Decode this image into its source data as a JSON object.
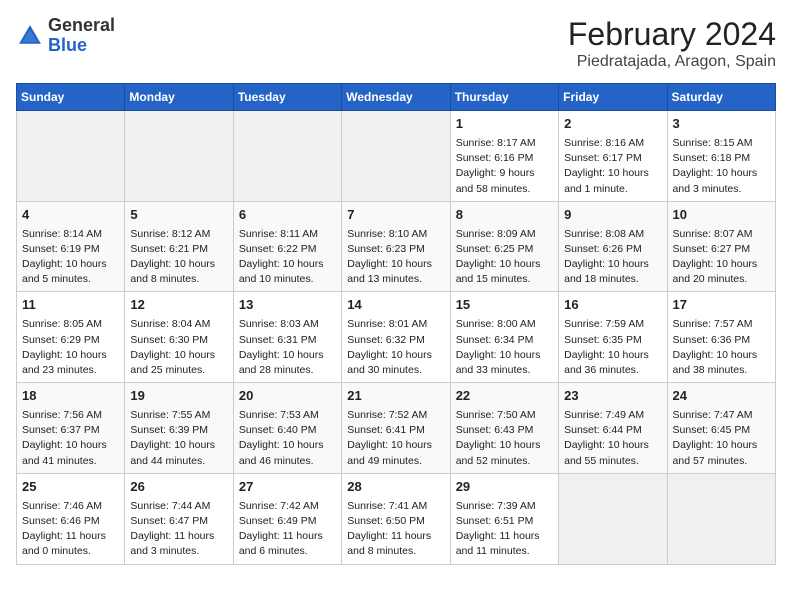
{
  "header": {
    "logo_general": "General",
    "logo_blue": "Blue",
    "title": "February 2024",
    "subtitle": "Piedratajada, Aragon, Spain"
  },
  "days_of_week": [
    "Sunday",
    "Monday",
    "Tuesday",
    "Wednesday",
    "Thursday",
    "Friday",
    "Saturday"
  ],
  "weeks": [
    [
      {
        "num": "",
        "info": ""
      },
      {
        "num": "",
        "info": ""
      },
      {
        "num": "",
        "info": ""
      },
      {
        "num": "",
        "info": ""
      },
      {
        "num": "1",
        "info": "Sunrise: 8:17 AM\nSunset: 6:16 PM\nDaylight: 9 hours\nand 58 minutes."
      },
      {
        "num": "2",
        "info": "Sunrise: 8:16 AM\nSunset: 6:17 PM\nDaylight: 10 hours\nand 1 minute."
      },
      {
        "num": "3",
        "info": "Sunrise: 8:15 AM\nSunset: 6:18 PM\nDaylight: 10 hours\nand 3 minutes."
      }
    ],
    [
      {
        "num": "4",
        "info": "Sunrise: 8:14 AM\nSunset: 6:19 PM\nDaylight: 10 hours\nand 5 minutes."
      },
      {
        "num": "5",
        "info": "Sunrise: 8:12 AM\nSunset: 6:21 PM\nDaylight: 10 hours\nand 8 minutes."
      },
      {
        "num": "6",
        "info": "Sunrise: 8:11 AM\nSunset: 6:22 PM\nDaylight: 10 hours\nand 10 minutes."
      },
      {
        "num": "7",
        "info": "Sunrise: 8:10 AM\nSunset: 6:23 PM\nDaylight: 10 hours\nand 13 minutes."
      },
      {
        "num": "8",
        "info": "Sunrise: 8:09 AM\nSunset: 6:25 PM\nDaylight: 10 hours\nand 15 minutes."
      },
      {
        "num": "9",
        "info": "Sunrise: 8:08 AM\nSunset: 6:26 PM\nDaylight: 10 hours\nand 18 minutes."
      },
      {
        "num": "10",
        "info": "Sunrise: 8:07 AM\nSunset: 6:27 PM\nDaylight: 10 hours\nand 20 minutes."
      }
    ],
    [
      {
        "num": "11",
        "info": "Sunrise: 8:05 AM\nSunset: 6:29 PM\nDaylight: 10 hours\nand 23 minutes."
      },
      {
        "num": "12",
        "info": "Sunrise: 8:04 AM\nSunset: 6:30 PM\nDaylight: 10 hours\nand 25 minutes."
      },
      {
        "num": "13",
        "info": "Sunrise: 8:03 AM\nSunset: 6:31 PM\nDaylight: 10 hours\nand 28 minutes."
      },
      {
        "num": "14",
        "info": "Sunrise: 8:01 AM\nSunset: 6:32 PM\nDaylight: 10 hours\nand 30 minutes."
      },
      {
        "num": "15",
        "info": "Sunrise: 8:00 AM\nSunset: 6:34 PM\nDaylight: 10 hours\nand 33 minutes."
      },
      {
        "num": "16",
        "info": "Sunrise: 7:59 AM\nSunset: 6:35 PM\nDaylight: 10 hours\nand 36 minutes."
      },
      {
        "num": "17",
        "info": "Sunrise: 7:57 AM\nSunset: 6:36 PM\nDaylight: 10 hours\nand 38 minutes."
      }
    ],
    [
      {
        "num": "18",
        "info": "Sunrise: 7:56 AM\nSunset: 6:37 PM\nDaylight: 10 hours\nand 41 minutes."
      },
      {
        "num": "19",
        "info": "Sunrise: 7:55 AM\nSunset: 6:39 PM\nDaylight: 10 hours\nand 44 minutes."
      },
      {
        "num": "20",
        "info": "Sunrise: 7:53 AM\nSunset: 6:40 PM\nDaylight: 10 hours\nand 46 minutes."
      },
      {
        "num": "21",
        "info": "Sunrise: 7:52 AM\nSunset: 6:41 PM\nDaylight: 10 hours\nand 49 minutes."
      },
      {
        "num": "22",
        "info": "Sunrise: 7:50 AM\nSunset: 6:43 PM\nDaylight: 10 hours\nand 52 minutes."
      },
      {
        "num": "23",
        "info": "Sunrise: 7:49 AM\nSunset: 6:44 PM\nDaylight: 10 hours\nand 55 minutes."
      },
      {
        "num": "24",
        "info": "Sunrise: 7:47 AM\nSunset: 6:45 PM\nDaylight: 10 hours\nand 57 minutes."
      }
    ],
    [
      {
        "num": "25",
        "info": "Sunrise: 7:46 AM\nSunset: 6:46 PM\nDaylight: 11 hours\nand 0 minutes."
      },
      {
        "num": "26",
        "info": "Sunrise: 7:44 AM\nSunset: 6:47 PM\nDaylight: 11 hours\nand 3 minutes."
      },
      {
        "num": "27",
        "info": "Sunrise: 7:42 AM\nSunset: 6:49 PM\nDaylight: 11 hours\nand 6 minutes."
      },
      {
        "num": "28",
        "info": "Sunrise: 7:41 AM\nSunset: 6:50 PM\nDaylight: 11 hours\nand 8 minutes."
      },
      {
        "num": "29",
        "info": "Sunrise: 7:39 AM\nSunset: 6:51 PM\nDaylight: 11 hours\nand 11 minutes."
      },
      {
        "num": "",
        "info": ""
      },
      {
        "num": "",
        "info": ""
      }
    ]
  ]
}
